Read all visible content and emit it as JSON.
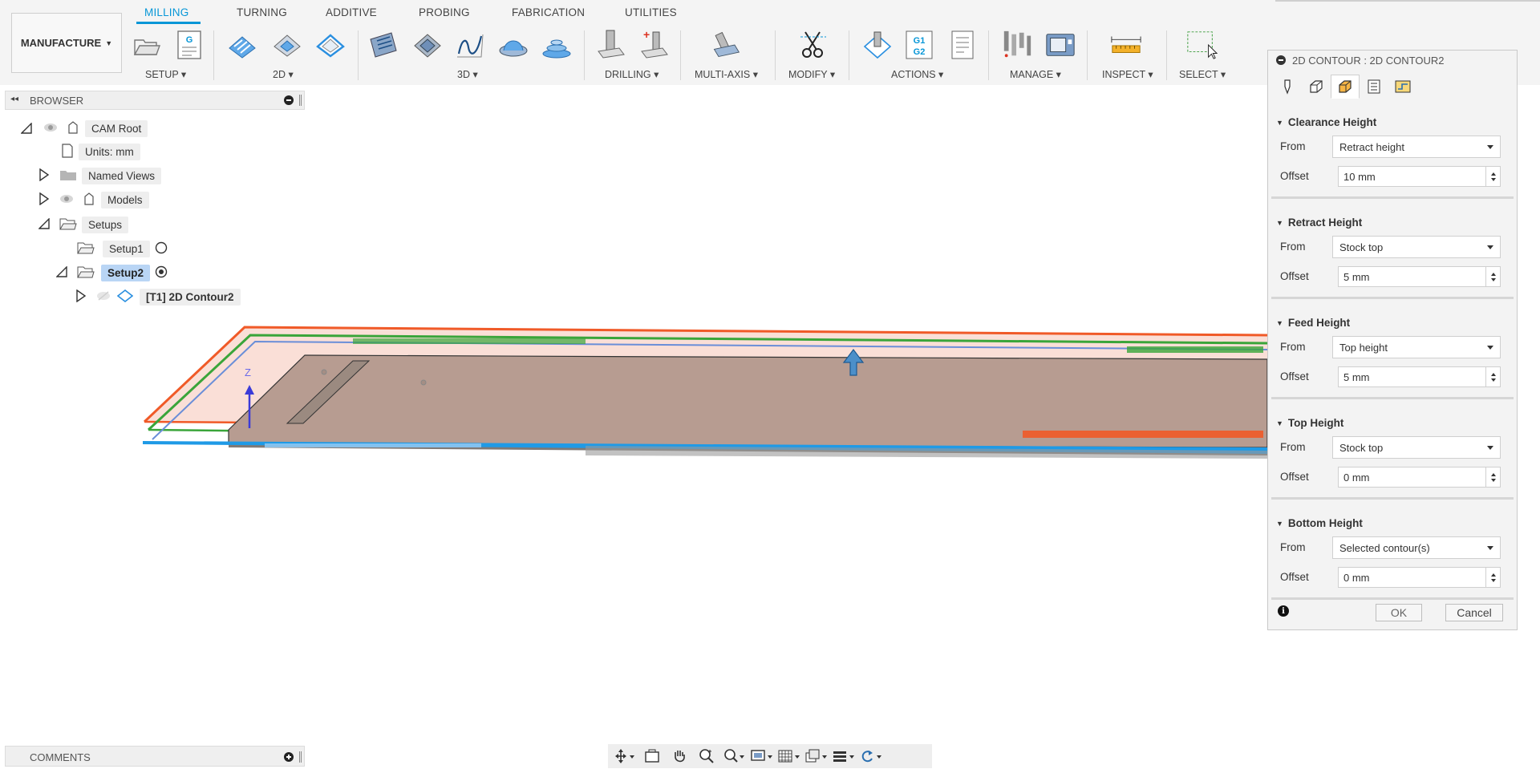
{
  "toolbar": {
    "tabs": [
      "MILLING",
      "TURNING",
      "ADDITIVE",
      "PROBING",
      "FABRICATION",
      "UTILITIES"
    ],
    "workspace": "MANUFACTURE",
    "groups": [
      "SETUP",
      "2D",
      "3D",
      "DRILLING",
      "MULTI-AXIS",
      "MODIFY",
      "ACTIONS",
      "MANAGE",
      "INSPECT",
      "SELECT"
    ],
    "gcode_top": "G1",
    "gcode_bottom": "G2",
    "accent_color": "#0696d7"
  },
  "browser": {
    "title": "BROWSER",
    "items": [
      {
        "label": "CAM Root"
      },
      {
        "label": "Units: mm"
      },
      {
        "label": "Named Views"
      },
      {
        "label": "Models"
      },
      {
        "label": "Setups"
      },
      {
        "label": "Setup1"
      },
      {
        "label": "Setup2"
      },
      {
        "label": "[T1] 2D Contour2"
      }
    ]
  },
  "viewport": {
    "axis_label": "Z"
  },
  "dialog": {
    "title": "2D CONTOUR : 2D CONTOUR2",
    "sections": [
      {
        "title": "Clearance Height",
        "from_label": "From",
        "from_value": "Retract height",
        "offset_label": "Offset",
        "offset_value": "10 mm"
      },
      {
        "title": "Retract Height",
        "from_label": "From",
        "from_value": "Stock top",
        "offset_label": "Offset",
        "offset_value": "5 mm"
      },
      {
        "title": "Feed Height",
        "from_label": "From",
        "from_value": "Top height",
        "offset_label": "Offset",
        "offset_value": "5 mm"
      },
      {
        "title": "Top Height",
        "from_label": "From",
        "from_value": "Stock top",
        "offset_label": "Offset",
        "offset_value": "0 mm"
      },
      {
        "title": "Bottom Height",
        "from_label": "From",
        "from_value": "Selected contour(s)",
        "offset_label": "Offset",
        "offset_value": "0 mm"
      }
    ],
    "ok_label": "OK",
    "cancel_label": "Cancel"
  },
  "comments": {
    "title": "COMMENTS"
  }
}
